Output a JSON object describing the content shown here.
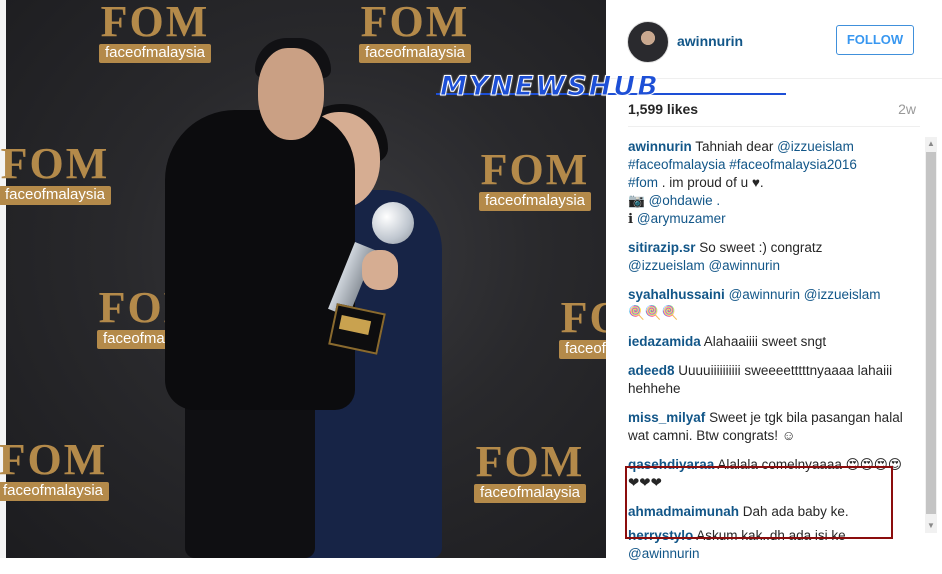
{
  "watermark": "MYNEWSHUB",
  "photo": {
    "backdrop_logo_text": "FOM",
    "backdrop_logo_sub": "faceofmalaysia"
  },
  "post": {
    "username": "awinnurin",
    "follow_label": "FOLLOW",
    "likes": "1,599 likes",
    "time": "2w"
  },
  "caption": {
    "user": "awinnurin",
    "line1_text": "Tahniah dear",
    "mention1": "@izzueislam",
    "hashtags1": "#faceofmalaysia #faceofmalaysia2016",
    "hashtag2": "#fom",
    "line2_text": ". im proud of u",
    "heart": "♥.",
    "camera_icon": "📷",
    "mention2": "@ohdawie .",
    "pin_icon": "ℹ",
    "mention3": "@arymuzamer"
  },
  "comments": [
    {
      "user": "sitirazip.sr",
      "text": "So sweet :) congratz",
      "mentions": "@izzueislam @awinnurin"
    },
    {
      "user": "syahalhussaini",
      "mentions": "@awinnurin @izzueislam",
      "emoji": "🍭🍭🍭"
    },
    {
      "user": "iedazamida",
      "text": "Alahaaiiii sweet sngt"
    },
    {
      "user": "adeed8",
      "text": "Uuuuiiiiiiiiii sweeeetttttnyaaaa lahaiii hehhehe"
    },
    {
      "user": "miss_milyaf",
      "text": "Sweet je tgk bila pasangan halal wat camni. Btw congrats! ☺"
    },
    {
      "user": "qasehdiyaraa",
      "text": "Alalala comelnyaaaa 😍😍😍😍❤❤❤"
    },
    {
      "user": "ahmadmaimunah",
      "text": "Dah ada baby ke."
    },
    {
      "user": "herrystylo",
      "text": "Askum kak..dh ada isi ke",
      "mentions": "@awinnurin"
    }
  ],
  "colors": {
    "link": "#125688",
    "follow": "#3897f0",
    "highlight_border": "#8b0d0d",
    "watermark": "#1d4fd6"
  }
}
